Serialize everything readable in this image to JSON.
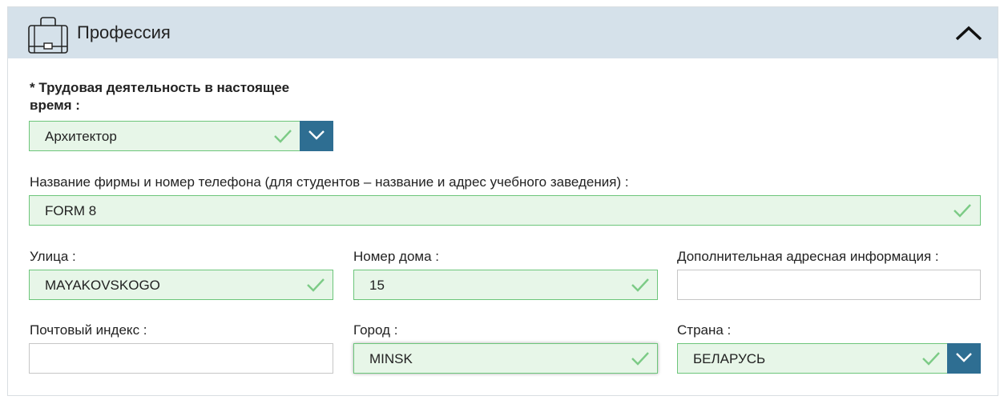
{
  "section": {
    "title": "Профессия"
  },
  "occupation": {
    "label": "* Трудовая деятельность в настоящее время :",
    "value": "Архитектор"
  },
  "company": {
    "label": "Название фирмы и номер телефона (для студентов – название и адрес учебного заведения) :",
    "value": "FORM 8"
  },
  "street": {
    "label": "Улица :",
    "value": "MAYAKOVSKOGO"
  },
  "house_number": {
    "label": "Номер дома :",
    "value": "15"
  },
  "address_extra": {
    "label": "Дополнительная адресная информация :",
    "value": ""
  },
  "postal_code": {
    "label": "Почтовый индекс :",
    "value": ""
  },
  "city": {
    "label": "Город :",
    "value": "MINSK"
  },
  "country": {
    "label": "Страна :",
    "value": "БЕЛАРУСЬ"
  },
  "colors": {
    "header_bg": "#d5e1ea",
    "valid_bg": "#e7f6e8",
    "valid_border": "#6cc57a",
    "dropdown_bg": "#2e6e92"
  }
}
